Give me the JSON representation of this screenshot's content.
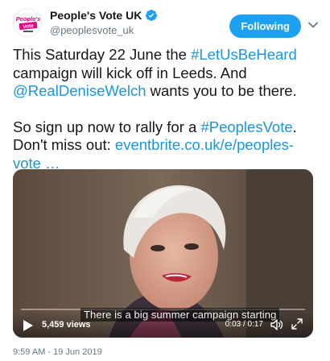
{
  "tweet": {
    "display_name": "People's Vote UK",
    "handle": "@peoplesvote_uk",
    "verified": true,
    "follow_label": "Following",
    "avatar_text": "People's Vote",
    "text": {
      "line1_a": "This Saturday 22 June the ",
      "hashtag1": "#LetUsBeHeard",
      "line2": "campaign will kick off in Leeds. And",
      "mention": "@RealDeniseWelch",
      "line3_b": " wants you to be there.",
      "line4_a": "So sign up now to rally for a ",
      "hashtag2": "#PeoplesVote",
      "line4_b": ".",
      "line5_a": "Don't miss out: ",
      "link_a": "eventbrite.co.uk/e/peoples-",
      "link_b": "vote …"
    },
    "timestamp": "9:59 AM - 19 Jun 2019"
  },
  "video": {
    "caption": "There is a big summer campaign starting",
    "views": "5,459 views",
    "timecode": "0:03 / 0:17",
    "progress": 0.18
  },
  "colors": {
    "accent": "#1da1f2",
    "link": "#1b95e0",
    "text": "#14171a",
    "muted": "#657786"
  }
}
